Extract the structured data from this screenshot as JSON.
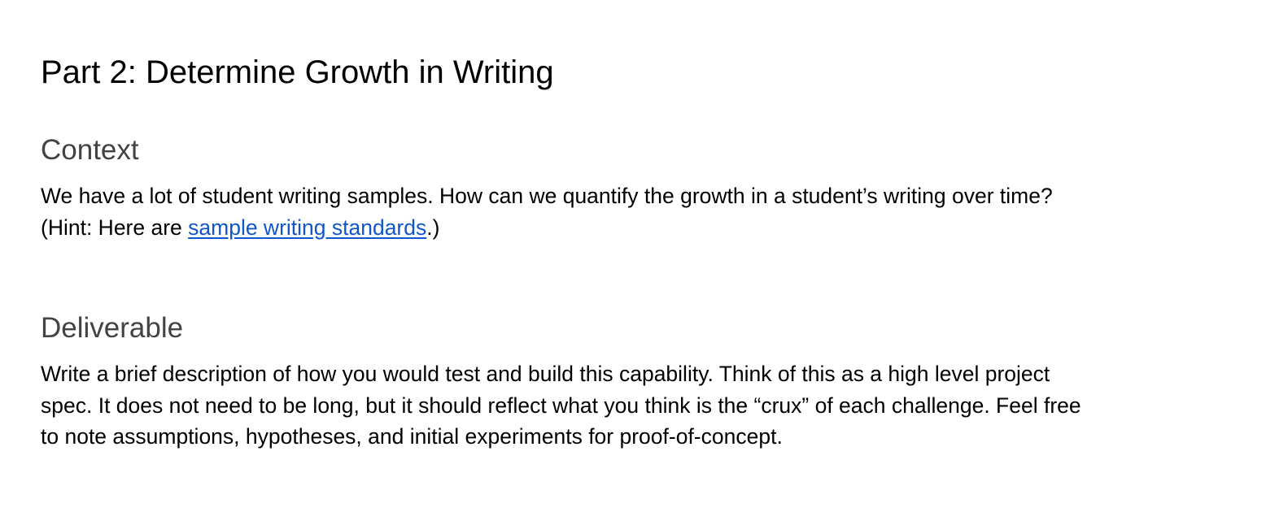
{
  "document": {
    "title": "Part 2: Determine Growth in Writing",
    "context": {
      "heading": "Context",
      "line1": "We have a lot of student writing samples. How can we quantify the growth in a student’s writing over time?",
      "line2_prefix": "(Hint: Here are ",
      "link_text": "sample writing standards",
      "line2_suffix": ".)"
    },
    "deliverable": {
      "heading": "Deliverable",
      "line1": "Write a brief description of how you would test and build this capability. Think of this as a high level project",
      "line2": "spec. It does not need to be long, but it should reflect what you think is the “crux” of each challenge. Feel free",
      "line3": "to note assumptions, hypotheses, and initial experiments for proof-of-concept."
    }
  },
  "colors": {
    "text": "#000000",
    "heading": "#434343",
    "link": "#1155cc",
    "background": "#ffffff"
  }
}
